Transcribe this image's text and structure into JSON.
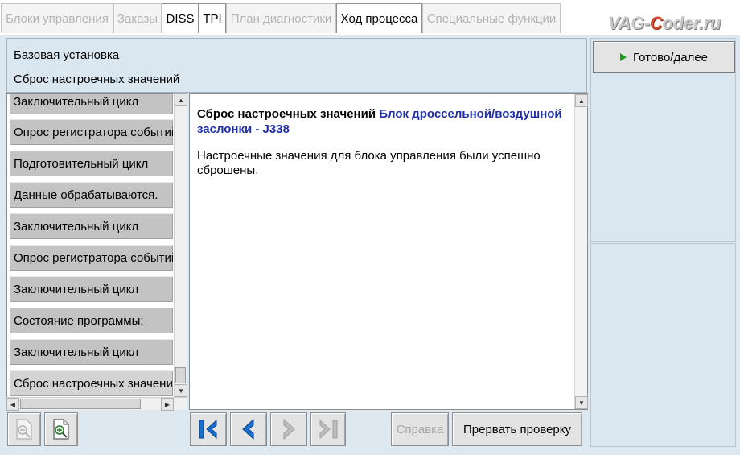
{
  "tabs": [
    {
      "label": "Блоки управления",
      "active": false
    },
    {
      "label": "Заказы",
      "active": false
    },
    {
      "label": "DISS",
      "active": true
    },
    {
      "label": "TPI",
      "active": true
    },
    {
      "label": "План диагностики",
      "active": false
    },
    {
      "label": "Ход процесса",
      "active": true
    },
    {
      "label": "Специальные функции",
      "active": false
    }
  ],
  "brand": {
    "part1": "VAG-",
    "accent": "C",
    "part2": "oder.ru"
  },
  "header": {
    "line1": "Базовая установка",
    "line2": "Сброс настроечных значений"
  },
  "actions": {
    "done_label": "Готово/далее"
  },
  "steps": [
    "Заключительный цикл",
    "Опрос регистратора событий",
    "Подготовительный цикл",
    "Данные обрабатываются.",
    "Заключительный цикл",
    "Опрос регистратора событий",
    "Заключительный цикл",
    "Состояние программы:",
    "Заключительный цикл",
    "Сброс настроечных значений"
  ],
  "content": {
    "title_black": "Сброс настроечных значений ",
    "title_blue": "Блок дроссельной/воздушной заслонки - J338",
    "body": "Настроечные значения для блока управления были успешно сброшены."
  },
  "toolbar": {
    "help_label": "Справка",
    "abort_label": "Прервать проверку"
  },
  "colors": {
    "panel_bg": "#dde8f1",
    "title_blue": "#1f2fa8",
    "nav_blue": "#1b6fd1",
    "play_green": "#1e9b1e"
  }
}
